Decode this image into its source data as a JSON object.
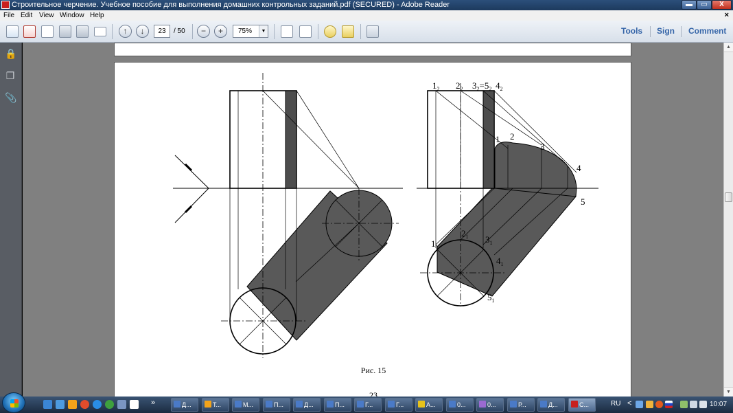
{
  "window": {
    "title": "Строительное черчение. Учебное пособие для выполнения домашних контрольных заданий.pdf (SECURED) - Adobe Reader",
    "min_label": "▬",
    "max_label": "▭",
    "close_label": "X"
  },
  "menu": {
    "items": [
      "File",
      "Edit",
      "View",
      "Window",
      "Help"
    ],
    "close_label": "×"
  },
  "toolbar": {
    "current_page": "23",
    "page_count": "/ 50",
    "zoom": "75%",
    "prev_icon": "↑",
    "next_icon": "↓",
    "zoom_out_icon": "−",
    "zoom_in_icon": "+",
    "links": {
      "tools": "Tools",
      "sign": "Sign",
      "comment": "Comment"
    }
  },
  "leftnav": {
    "icons": [
      "lock-icon",
      "pages-icon",
      "attachment-icon"
    ],
    "glyphs": [
      "🔒",
      "❐",
      "📎"
    ]
  },
  "document": {
    "caption": "Рис. 15",
    "page_number": "23",
    "labels": {
      "l12": "1",
      "l12s": "2",
      "l22": "2",
      "l22s": "2",
      "l3": "3",
      "l3s": "2",
      "l35": "=5",
      "l35s": "2",
      "l42": "4",
      "l42s": "2",
      "p1": "1",
      "p2": "2",
      "p3": "3",
      "p4": "4",
      "p5": "5",
      "q1": "1",
      "q1s": "1",
      "q2": "2",
      "q2s": "1",
      "q3": "3",
      "q3s": "1",
      "q4": "4",
      "q4s": "1",
      "q5": "5",
      "q5s": "1"
    }
  },
  "taskbar": {
    "buttons": [
      {
        "label": "Д...",
        "color": "#4a7ac7"
      },
      {
        "label": "Т...",
        "color": "#f2a31a"
      },
      {
        "label": "М...",
        "color": "#4a7ac7"
      },
      {
        "label": "П...",
        "color": "#4a7ac7"
      },
      {
        "label": "Д...",
        "color": "#4a7ac7"
      },
      {
        "label": "П...",
        "color": "#4a7ac7"
      },
      {
        "label": "Г...",
        "color": "#4a7ac7"
      },
      {
        "label": "Г...",
        "color": "#4a7ac7"
      },
      {
        "label": "А...",
        "color": "#e6c21b"
      },
      {
        "label": "0...",
        "color": "#4a7ac7"
      },
      {
        "label": "0...",
        "color": "#9a6ad1"
      },
      {
        "label": "Р...",
        "color": "#4a7ac7"
      },
      {
        "label": "Д...",
        "color": "#4a7ac7"
      },
      {
        "label": "С...",
        "color": "#c8201e"
      }
    ],
    "more_label": "»",
    "lang": "RU",
    "tray_arrow": "<",
    "clock": "10:07"
  },
  "colors": {
    "shadow": "#595959",
    "strip": "#4d4d4d",
    "doc_bg": "#808080",
    "accent_link": "#3565a8"
  }
}
